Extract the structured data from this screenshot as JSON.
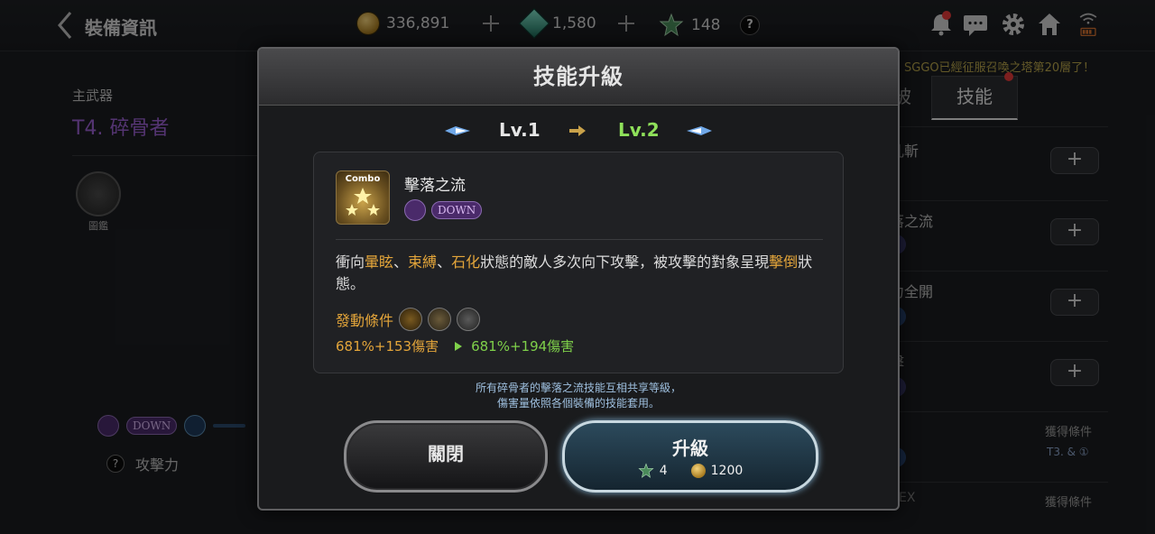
{
  "topbar": {
    "title": "裝備資訊",
    "gold": "336,891",
    "gems": "1,580",
    "stars": "148",
    "help": "?"
  },
  "left": {
    "subtitle": "主武器",
    "weapon_tier": "T4.",
    "weapon_name": "碎骨者",
    "book_label": "圖鑑",
    "badge_down": "DOWN",
    "attack_label": "攻擊力",
    "attack_help": "?"
  },
  "right": {
    "notice": "SGGO已經征服召喚之塔第20層了！",
    "tab_partial": "被",
    "tab_skill": "技能",
    "items": [
      "亂斬",
      "落之流",
      "力全開",
      "擊"
    ],
    "cond_label_1": "獲得條件",
    "cond_value_1": "T3. & ①",
    "cond_label_2": "獲得條件",
    "ex_partial": "EX"
  },
  "modal": {
    "title": "技能升級",
    "lv_from": "Lv.1",
    "lv_to": "Lv.2",
    "skill_icon_text": "Combo",
    "skill_name": "擊落之流",
    "badge_down": "DOWN",
    "desc_1": "衝向",
    "desc_2": "暈眩",
    "desc_3": "、",
    "desc_4": "束縛",
    "desc_5": "、",
    "desc_6": "石化",
    "desc_7": "狀態的敵人多次向下攻擊，被攻擊的對象呈現",
    "desc_8": "擊倒",
    "desc_9": "狀態。",
    "cond_label": "發動條件",
    "dmg_old": "681%+153傷害",
    "dmg_new": "681%+194傷害",
    "note_1": "所有碎骨者的擊落之流技能互相共享等級，",
    "note_2": "傷害量依照各個裝備的技能套用。",
    "close_label": "關閉",
    "upgrade_label": "升級",
    "cost_star": "4",
    "cost_gold": "1200"
  }
}
